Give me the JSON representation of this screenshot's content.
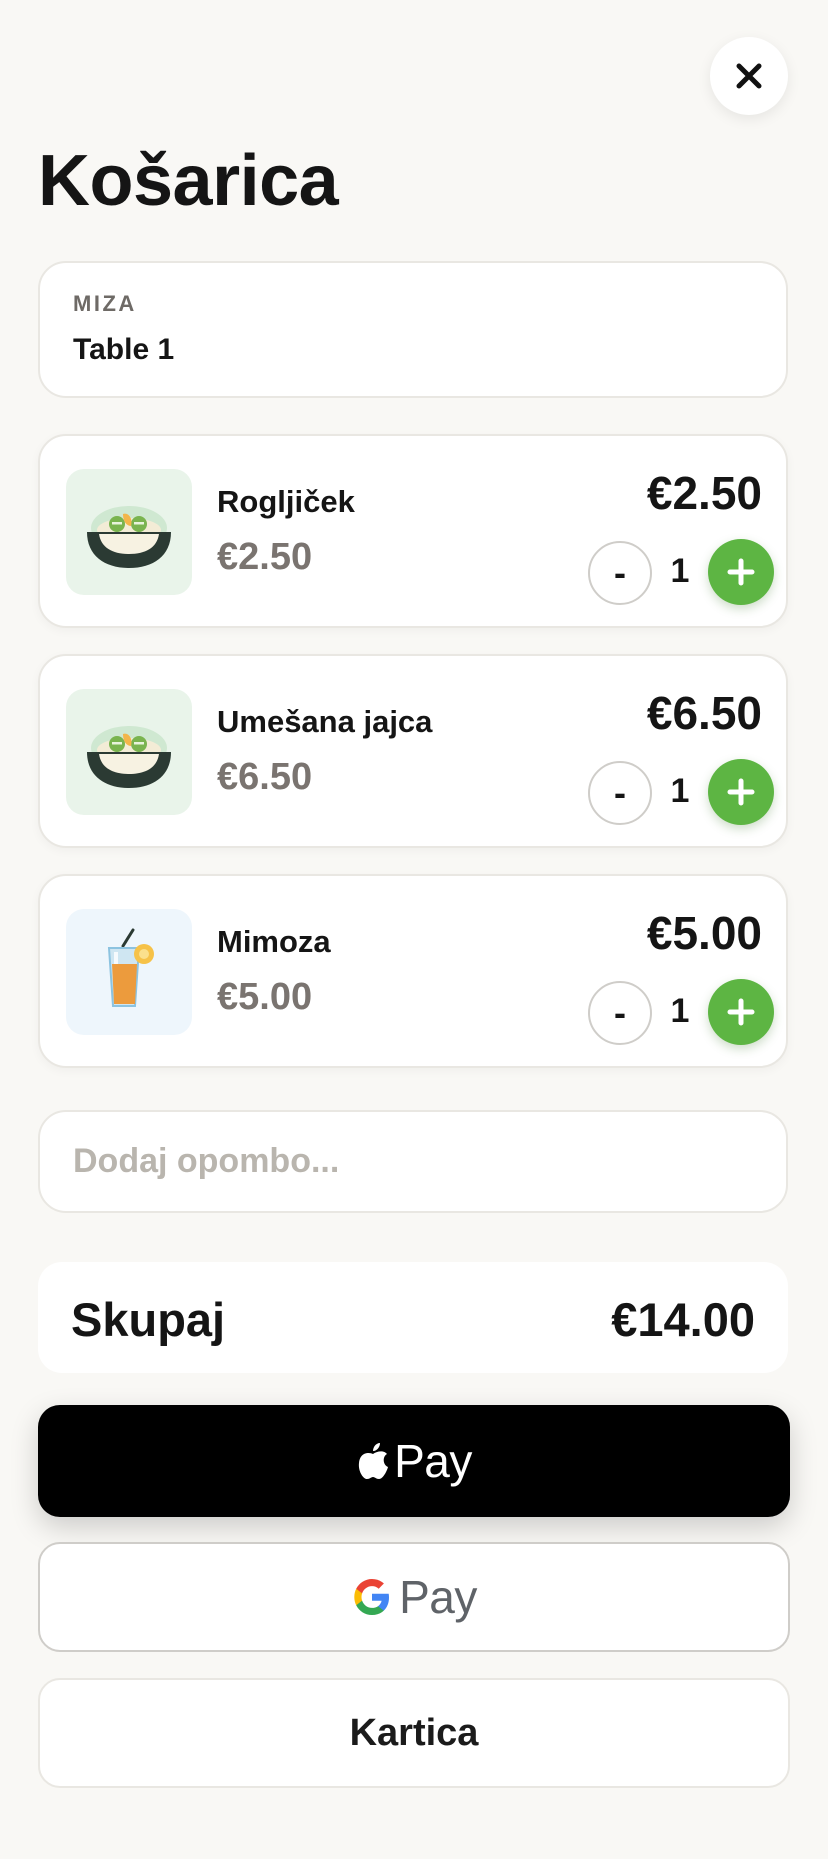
{
  "header": {
    "title": "Košarica",
    "close_icon": "close-icon"
  },
  "table": {
    "label": "MIZA",
    "value": "Table 1"
  },
  "items": [
    {
      "name": "Rogljiček",
      "unit_price": "€2.50",
      "total": "€2.50",
      "quantity": "1",
      "minus_label": "-",
      "icon": "salad-bowl-icon"
    },
    {
      "name": "Umešana jajca",
      "unit_price": "€6.50",
      "total": "€6.50",
      "quantity": "1",
      "minus_label": "-",
      "icon": "salad-bowl-icon"
    },
    {
      "name": "Mimoza",
      "unit_price": "€5.00",
      "total": "€5.00",
      "quantity": "1",
      "minus_label": "-",
      "icon": "cocktail-glass-icon"
    }
  ],
  "note": {
    "placeholder": "Dodaj opombo...",
    "value": ""
  },
  "summary": {
    "label": "Skupaj",
    "total": "€14.00"
  },
  "payment": {
    "apple_pay_label": "Pay",
    "google_pay_label": "Pay",
    "card_label": "Kartica"
  },
  "colors": {
    "background": "#f9f8f5",
    "accent_green": "#5db543",
    "muted_text": "#7a7470"
  }
}
